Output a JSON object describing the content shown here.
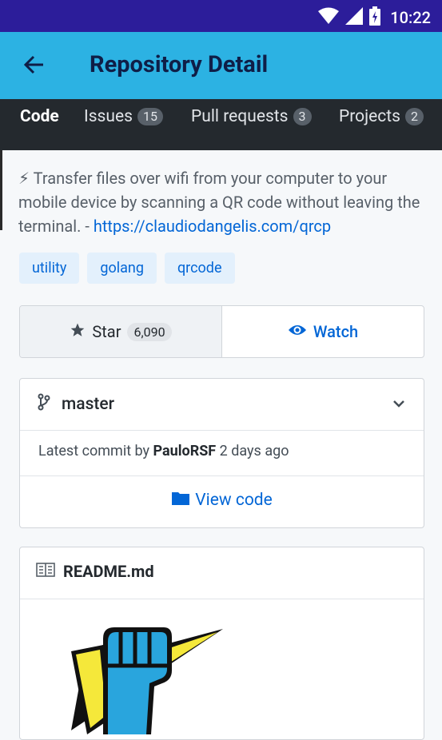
{
  "status_bar": {
    "time": "10:22"
  },
  "app_bar": {
    "title": "Repository Detail"
  },
  "tabs": [
    {
      "label": "Code"
    },
    {
      "label": "Issues",
      "count": "15"
    },
    {
      "label": "Pull requests",
      "count": "3"
    },
    {
      "label": "Projects",
      "count": "2"
    }
  ],
  "repo": {
    "description": "⚡ Transfer files over wifi from your computer to your mobile device by scanning a QR code without leaving the terminal. - ",
    "link": "https://claudiodangelis.com/qrcp",
    "topics": [
      "utility",
      "golang",
      "qrcode"
    ]
  },
  "actions": {
    "star_label": "Star",
    "star_count": "6,090",
    "watch_label": "Watch"
  },
  "branch": {
    "name": "master",
    "commit_prefix": "Latest commit by ",
    "commit_author": "PauloRSF",
    "commit_time": " 2 days ago",
    "view_code_label": "View code"
  },
  "readme": {
    "title": "README.md"
  },
  "colors": {
    "status_bar": "#2c1d9a",
    "app_bar": "#2cb2e3",
    "tab_bar": "#24292e",
    "link": "#0366d6"
  },
  "icons": [
    "back-arrow-icon",
    "wifi-icon",
    "signal-icon",
    "battery-icon",
    "star-icon",
    "eye-icon",
    "git-branch-icon",
    "chevron-down-icon",
    "folder-icon",
    "book-icon"
  ]
}
